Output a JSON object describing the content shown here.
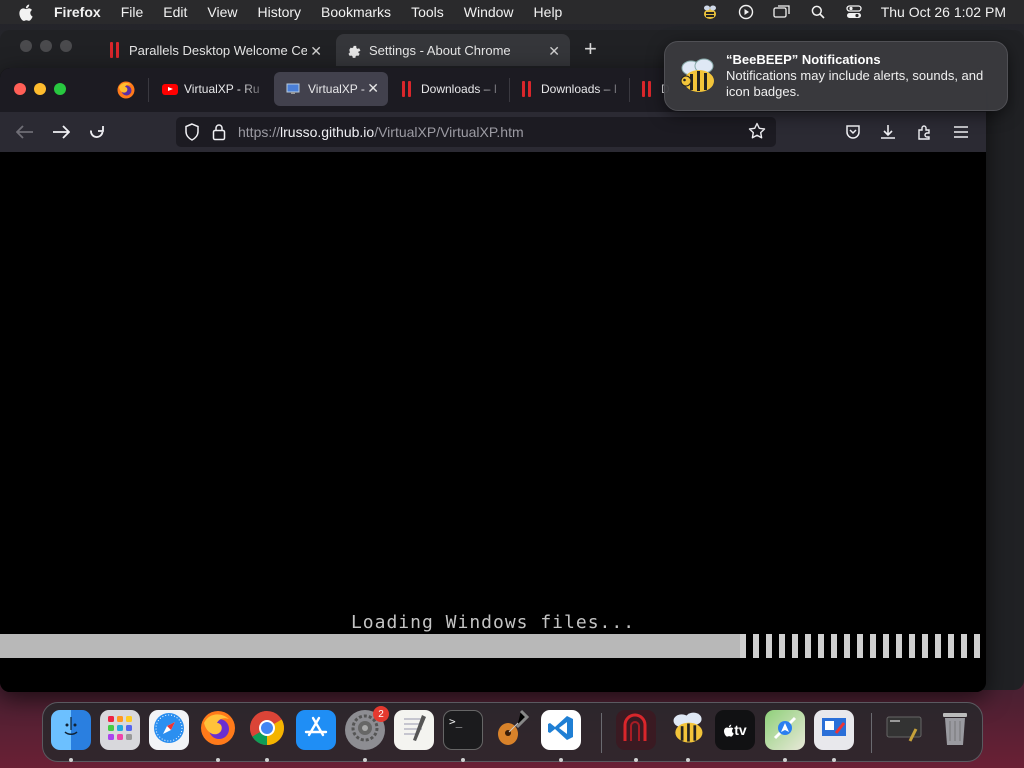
{
  "menubar": {
    "app_name": "Firefox",
    "menus": [
      "File",
      "Edit",
      "View",
      "History",
      "Bookmarks",
      "Tools",
      "Window",
      "Help"
    ],
    "clock": "Thu Oct 26  1:02 PM",
    "status_icons": [
      "beebeep-icon",
      "play-circle-icon",
      "screen-mirroring-icon",
      "search-icon",
      "control-center-icon"
    ]
  },
  "chrome_window": {
    "tabs": [
      {
        "label": "Parallels Desktop Welcome Ce",
        "icon": "parallels-icon"
      },
      {
        "label": "Settings - About Chrome",
        "icon": "gear-icon"
      }
    ],
    "new_tab": "+",
    "close_glyph": "✕"
  },
  "firefox": {
    "tabs": [
      {
        "label": "VirtualXP - Ru",
        "icon": "youtube-icon",
        "active": false
      },
      {
        "label": "VirtualXP -",
        "icon": "virtualxp-icon",
        "active": true
      },
      {
        "label": "Downloads – I",
        "icon": "parallels-icon",
        "active": false
      },
      {
        "label": "Downloads – I",
        "icon": "parallels-icon",
        "active": false
      },
      {
        "label": "D",
        "icon": "parallels-icon",
        "active": false
      }
    ],
    "close_glyph": "✕",
    "url": {
      "prefix": "https://",
      "host": "lrusso.github.io",
      "path": "/VirtualXP/VirtualXP.htm"
    },
    "content": {
      "loading_text": "Loading Windows files...",
      "progress": 0.75
    }
  },
  "notification": {
    "title": "“BeeBEEP” Notifications",
    "body": "Notifications may include alerts, sounds, and icon badges."
  },
  "dock": {
    "items": [
      {
        "name": "finder",
        "color": "#2a8cf0"
      },
      {
        "name": "launchpad",
        "color": "#d9d9dc"
      },
      {
        "name": "safari",
        "color": "#2b8ff0"
      },
      {
        "name": "firefox",
        "color": "#7a3fe0"
      },
      {
        "name": "chrome",
        "color": "#ffffff"
      },
      {
        "name": "app-store",
        "color": "#1f8ef5"
      },
      {
        "name": "system-settings",
        "color": "#8d8d92",
        "badge": "2"
      },
      {
        "name": "textedit",
        "color": "#f4f4f0"
      },
      {
        "name": "terminal",
        "color": "#1b1b1d"
      },
      {
        "name": "garageband",
        "color": "#2a2a2e"
      },
      {
        "name": "vscode",
        "color": "#ffffff"
      },
      {
        "name": "parallels-desktop",
        "color": "#3a1a22"
      },
      {
        "name": "beebeep",
        "color": "#e8c03a"
      },
      {
        "name": "apple-tv",
        "color": "#111113"
      },
      {
        "name": "maps",
        "color": "#7fc46a"
      },
      {
        "name": "remote-desktop",
        "color": "#e8e8ec"
      },
      {
        "name": "screen-capture",
        "color": "#3a3a3e"
      },
      {
        "name": "trash",
        "color": "#9a9aa0"
      }
    ],
    "terminal_glyph": ">_",
    "appletv_label": "tv"
  }
}
